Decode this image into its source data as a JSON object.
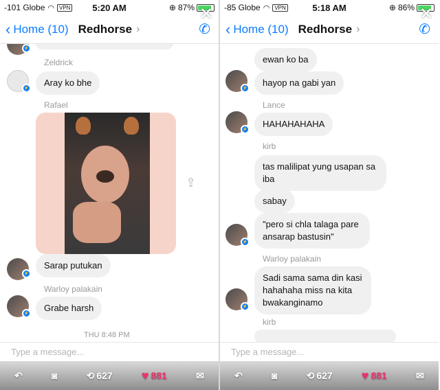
{
  "left": {
    "status": {
      "carrier": "-101 Globe",
      "vpn": "VPN",
      "time": "5:20 AM",
      "battery": "87%",
      "battery_level": 0.87
    },
    "nav": {
      "back_label": "Home (10)",
      "title": "Redhorse"
    },
    "messages": [
      {
        "name": "Zeldrick",
        "text": "Aray ko bhe"
      },
      {
        "name": "Rafael",
        "photo": true
      },
      {
        "text": "Sarap putukan"
      },
      {
        "name": "Warloy palakain",
        "text": "Grabe harsh"
      }
    ],
    "time_separator": "THU 8:48 PM",
    "composer_placeholder": "Type a message...",
    "bottom": {
      "retweets": "627",
      "likes": "881"
    }
  },
  "right": {
    "status": {
      "carrier": "-85 Globe",
      "vpn": "VPN",
      "time": "5:18 AM",
      "battery": "86%",
      "battery_level": 0.86
    },
    "nav": {
      "back_label": "Home (10)",
      "title": "Redhorse"
    },
    "messages": [
      {
        "text": "ewan ko ba"
      },
      {
        "text": "hayop na gabi yan"
      },
      {
        "name": "Lance",
        "text": "HAHAHAHAHA"
      },
      {
        "name": "kirb",
        "text": "tas malilipat yung usapan sa iba"
      },
      {
        "text": "sabay"
      },
      {
        "text": "\"pero si chla talaga pare ansarap bastusin\""
      },
      {
        "name": "Warloy palakain",
        "text": "Sadi sama sama din kasi hahahaha miss na kita bwakanginamo"
      },
      {
        "name": "kirb"
      }
    ],
    "composer_placeholder": "Type a message...",
    "bottom": {
      "retweets": "627",
      "likes": "881"
    }
  },
  "colors": {
    "accent": "#0a7cff",
    "bubble": "#f1f0f0",
    "name": "#9a9a9a"
  },
  "icons": [
    "wifi-icon",
    "battery-icon",
    "back-chevron-icon",
    "phone-icon",
    "close-icon",
    "messenger-badge-icon",
    "share-icon",
    "reply-icon",
    "camera-icon",
    "retweet-icon",
    "heart-icon",
    "mail-icon"
  ]
}
